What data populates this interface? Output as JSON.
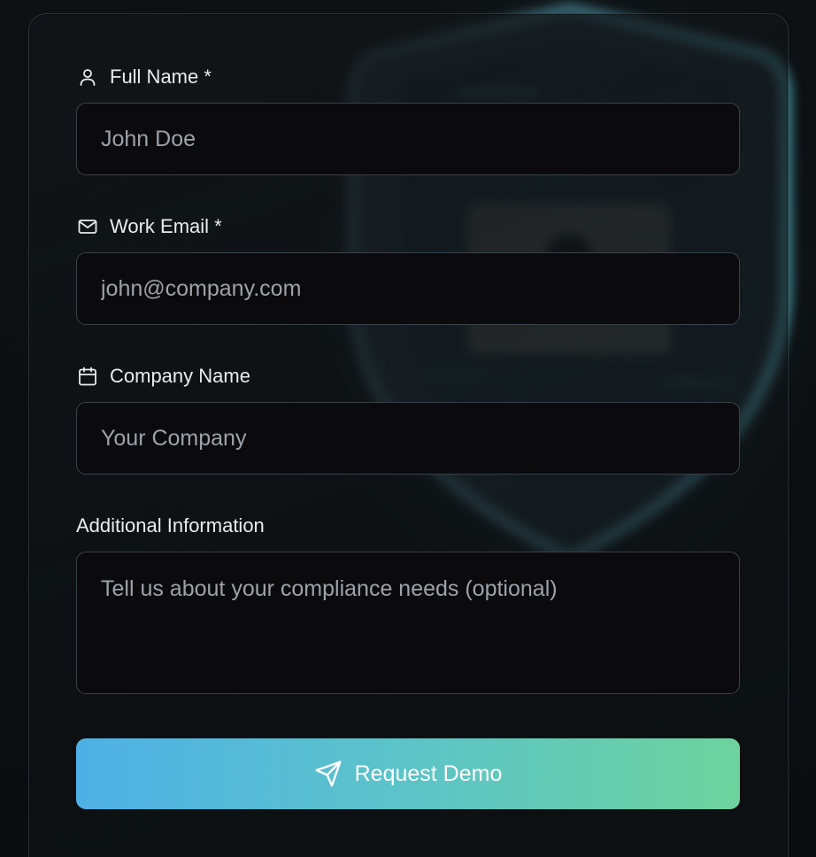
{
  "form": {
    "full_name": {
      "label": "Full Name *",
      "icon": "user-icon",
      "placeholder": "John Doe",
      "value": ""
    },
    "work_email": {
      "label": "Work Email *",
      "icon": "mail-icon",
      "placeholder": "john@company.com",
      "value": ""
    },
    "company_name": {
      "label": "Company Name",
      "icon": "calendar-icon",
      "placeholder": "Your Company",
      "value": ""
    },
    "additional_info": {
      "label": "Additional Information",
      "placeholder": "Tell us about your compliance needs (optional)",
      "value": ""
    },
    "submit": {
      "label": "Request Demo",
      "icon": "send-icon"
    }
  },
  "colors": {
    "background": "#0b0d0f",
    "input_bg": "#0b0b0e",
    "input_border": "#3a4148",
    "label_text": "#e9ecef",
    "placeholder_text": "#9ca2a9",
    "button_gradient_start": "#4fb0e6",
    "button_gradient_end": "#6dd39e"
  }
}
